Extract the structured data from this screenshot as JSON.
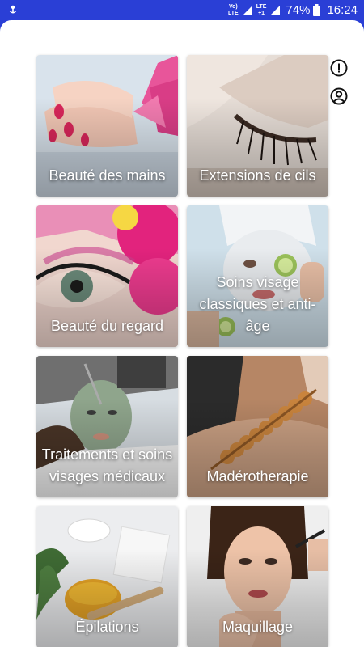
{
  "status_bar": {
    "app_icon": "notification-app-icon",
    "volte": "Vo)\nLTE",
    "lte": "LTE",
    "lte_sub": "+1",
    "battery_percent": "74%",
    "time": "16:24"
  },
  "side_icons": [
    {
      "name": "alert-circle-icon"
    },
    {
      "name": "account-circle-icon"
    }
  ],
  "tiles": [
    {
      "label": "Beauté des mains",
      "image": "manicured-hands-with-lily"
    },
    {
      "label": "Extensions de cils",
      "image": "eyelash-extensions-closeup"
    },
    {
      "label": "Beauté du regard",
      "image": "eye-makeup-with-pink-flowers"
    },
    {
      "label": "Soins visage classiques et anti-âge",
      "image": "woman-facial-mask-cucumber"
    },
    {
      "label": "Traitements et soins visages médicaux",
      "image": "medical-facial-treatment"
    },
    {
      "label": "Madérotherapie",
      "image": "wooden-roller-massage"
    },
    {
      "label": "Épilations",
      "image": "waxing-supplies"
    },
    {
      "label": "Maquillage",
      "image": "woman-makeup-portrait"
    }
  ],
  "colors": {
    "status_bar": "#2a3fd6",
    "sheet": "#ffffff",
    "label_text": "#ffffff"
  }
}
